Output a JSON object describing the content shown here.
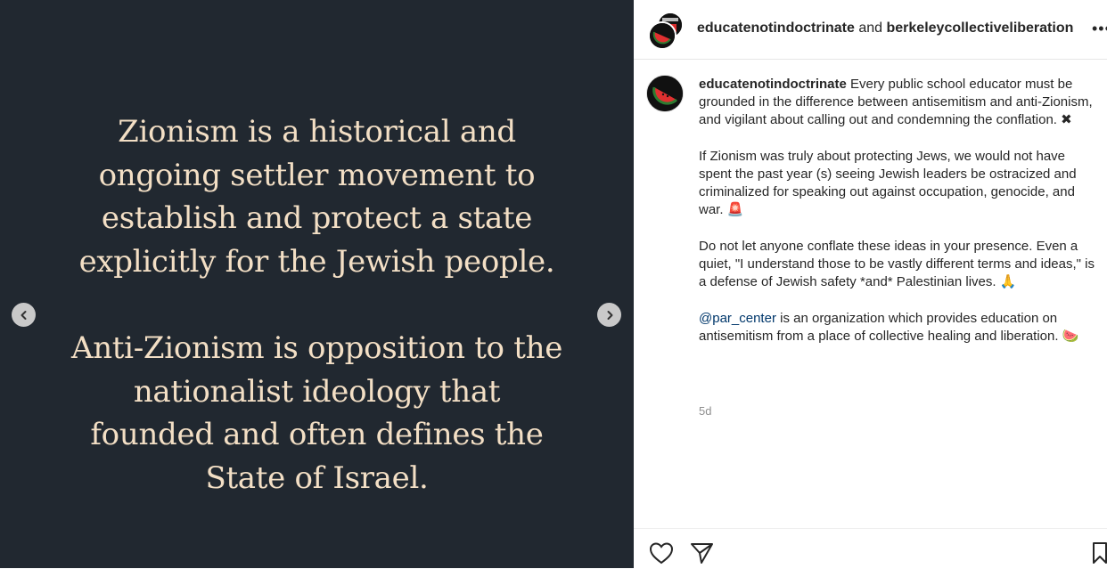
{
  "slide": {
    "paragraph1": [
      "Zionism is a historical and",
      "ongoing settler movement to",
      "establish and protect a state",
      "explicitly for the Jewish people."
    ],
    "paragraph2": [
      "Anti-Zionism is opposition to the",
      "nationalist ideology that",
      "founded and often defines the",
      "State of Israel."
    ],
    "prev_icon": "chevron-left-icon",
    "next_icon": "chevron-right-icon"
  },
  "header": {
    "user1": "educatenotindoctrinate",
    "joiner": " and ",
    "user2": "berkeleycollectiveliberation",
    "more_label": "•••"
  },
  "caption": {
    "username": "educatenotindoctrinate",
    "p1": " Every public school educator must be grounded in the difference between antisemitism and anti-Zionism, and vigilant about calling out and condemning the conflation. ✖",
    "p2": "If Zionism was truly about protecting Jews, we would not have spent the past year (s) seeing Jewish leaders be ostracized and criminalized for speaking out against occupation, genocide, and war. 🚨",
    "p3": "Do not let anyone conflate these ideas in your presence. Even a quiet, \"I understand those to be vastly different terms and ideas,\" is a defense of Jewish safety *and* Palestinian lives. 🙏",
    "mention": "@par_center",
    "p4": " is an organization which provides education on antisemitism from a place of collective healing and liberation. 🍉",
    "time": "5d"
  },
  "actions": [
    "heart-icon",
    "share-icon",
    "bookmark-icon"
  ],
  "colors": {
    "slide_bg": "#212830",
    "slide_text": "#f3dfc5",
    "mention": "#00376b"
  }
}
